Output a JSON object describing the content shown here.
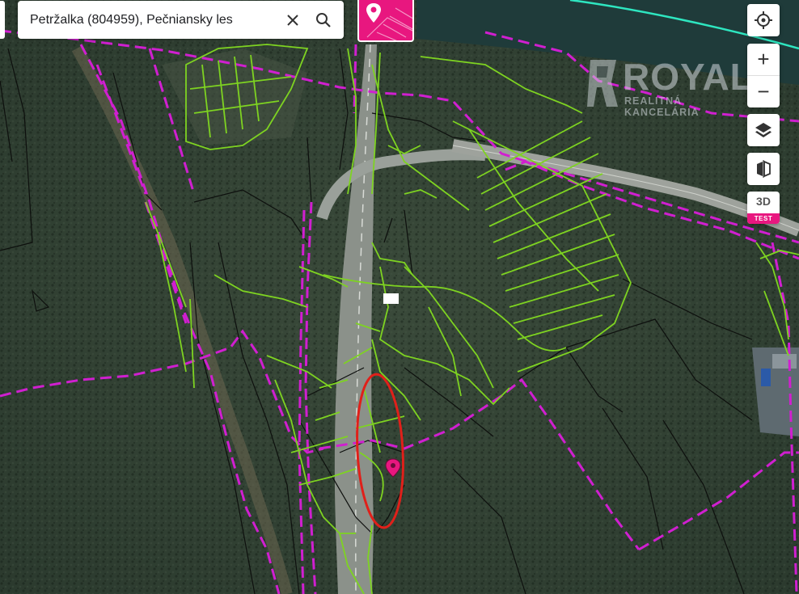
{
  "search": {
    "value": "Petržalka (804959), Pečniansky les",
    "clear_icon": "close-icon",
    "search_icon": "search-icon"
  },
  "watermark": {
    "brand": "ROYALS",
    "subtitle": "REALITNÁ KANCELÁRIA"
  },
  "controls": {
    "locate_icon": "crosshair-icon",
    "zoom_in": "+",
    "zoom_out": "−",
    "layers_icon": "layers-icon",
    "compare_icon": "compare-icon",
    "mode_3d": "3D",
    "mode_3d_badge": "TEST"
  },
  "colors": {
    "accent": "#e8177f",
    "parcel_green": "#7ed321",
    "boundary_magenta": "#d01fd0",
    "highlight_red": "#e0201a",
    "river_line": "#2ee6c0"
  }
}
